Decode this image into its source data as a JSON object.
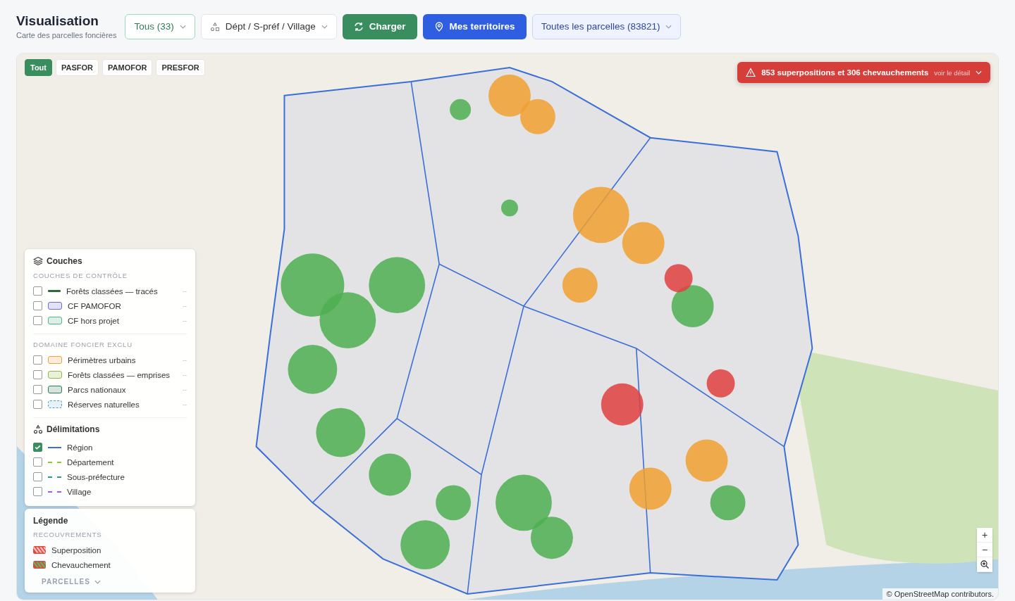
{
  "header": {
    "title": "Visualisation",
    "subtitle": "Carte des parcelles foncières"
  },
  "toolbar": {
    "filter": {
      "label": "Tous (33)"
    },
    "location": {
      "label": "Dépt / S-préf / Village"
    },
    "load_button": "Charger",
    "territories_button": "Mes territoires",
    "parcels": {
      "label": "Toutes les parcelles (83821)"
    }
  },
  "map": {
    "filter_tabs": [
      {
        "label": "Tout",
        "selected": true
      },
      {
        "label": "PASFOR",
        "selected": false
      },
      {
        "label": "PAMOFOR",
        "selected": false
      },
      {
        "label": "PRESFOR",
        "selected": false
      }
    ],
    "alert": {
      "text": "853 superpositions et 306 chevauchements",
      "link": "voir le détail"
    },
    "layers": {
      "title": "Couches",
      "sections": [
        {
          "heading": "COUCHES DE CONTRÔLE",
          "items": [
            {
              "label": "Forêts classées — tracés",
              "checked": false,
              "kind": "line",
              "color": "#2f6b3a",
              "value": "--"
            },
            {
              "label": "CF PAMOFOR",
              "checked": false,
              "kind": "fill",
              "color": "#6b6be0",
              "value": "--"
            },
            {
              "label": "CF hors projet",
              "checked": false,
              "kind": "fill",
              "color": "#4fb58a",
              "value": "--"
            }
          ]
        },
        {
          "heading": "DOMAINE FONCIER EXCLU",
          "items": [
            {
              "label": "Périmètres urbains",
              "checked": false,
              "kind": "fill",
              "color": "#f0a040",
              "value": "--"
            },
            {
              "label": "Forêts classées — emprises",
              "checked": false,
              "kind": "fill",
              "color": "#8fb84a",
              "value": "--"
            },
            {
              "label": "Parcs nationaux",
              "checked": false,
              "kind": "fill",
              "color": "#2f7a5a",
              "value": "--"
            },
            {
              "label": "Réserves naturelles",
              "checked": false,
              "kind": "dashed",
              "color": "#4aa0c0",
              "value": "--"
            }
          ]
        }
      ]
    },
    "delimitations": {
      "title": "Délimitations",
      "items": [
        {
          "label": "Région",
          "checked": true,
          "kind": "solid",
          "color": "#3b6fd8"
        },
        {
          "label": "Département",
          "checked": false,
          "kind": "dashed",
          "color": "#8cc63f"
        },
        {
          "label": "Sous-préfecture",
          "checked": false,
          "kind": "dashed",
          "color": "#2a9a8a"
        },
        {
          "label": "Village",
          "checked": false,
          "kind": "dashed",
          "color": "#a05ce0"
        }
      ]
    },
    "legend": {
      "title": "Légende",
      "heading": "RECOUVREMENTS",
      "items": [
        {
          "label": "Superposition",
          "color": "#f6c1bf"
        },
        {
          "label": "Chevauchement",
          "color": "#5cb85c"
        }
      ],
      "footer": "PARCELLES"
    },
    "zoom_controls": [
      "+",
      "−"
    ],
    "attribution": "© OpenStreetMap contributors."
  }
}
